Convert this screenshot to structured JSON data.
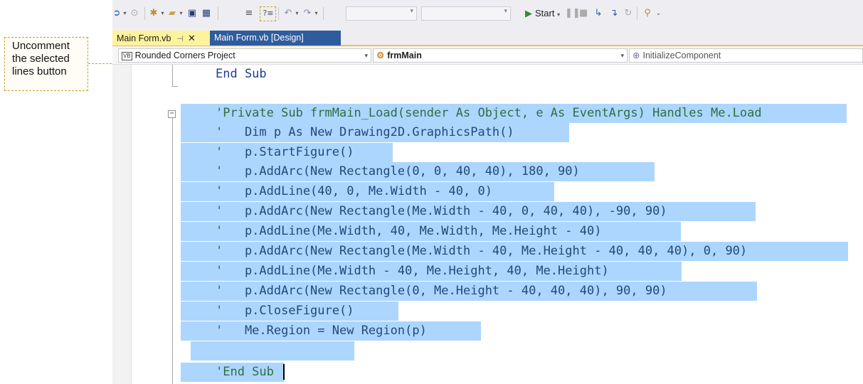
{
  "callout": {
    "text": "Uncomment\nthe selected\nlines button"
  },
  "toolbar": {
    "start_label": "Start",
    "buttons": [
      "back-icon",
      "forward-icon",
      "new-project-icon",
      "open-file-icon",
      "save-icon",
      "save-all-icon",
      "comment-icon",
      "uncomment-icon",
      "undo-icon",
      "redo-icon",
      "pause-icon",
      "stop-icon",
      "step-icon",
      "restart-icon",
      "find-icon"
    ]
  },
  "tabs": [
    {
      "label": "Main Form.vb",
      "active": true
    },
    {
      "label": "Main Form.vb [Design]",
      "active": false
    }
  ],
  "navbar": {
    "project": "Rounded Corners Project",
    "class": "frmMain",
    "member": "InitializeComponent"
  },
  "code": {
    "line1": "End Sub",
    "line2": "'Private Sub frmMain_Load(sender As Object, e As EventArgs) Handles Me.Load",
    "line3": "    Dim p As New Drawing2D.GraphicsPath()",
    "line4": "    p.StartFigure()",
    "line5": "    p.AddArc(New Rectangle(0, 0, 40, 40), 180, 90)",
    "line6": "    p.AddLine(40, 0, Me.Width - 40, 0)",
    "line7": "    p.AddArc(New Rectangle(Me.Width - 40, 0, 40, 40), -90, 90)",
    "line8": "    p.AddLine(Me.Width, 40, Me.Width, Me.Height - 40)",
    "line9": "    p.AddArc(New Rectangle(Me.Width - 40, Me.Height - 40, 40, 40), 0, 90)",
    "line10": "    p.AddLine(Me.Width - 40, Me.Height, 40, Me.Height)",
    "line11": "    p.AddArc(New Rectangle(0, Me.Height - 40, 40, 40), 90, 90)",
    "line12": "    p.CloseFigure()",
    "line13": "    Me.Region = New Region(p)",
    "line14": "'End Sub",
    "comment_prefix": "'"
  },
  "colors": {
    "selection": "#add6ff",
    "active_tab": "#fff29d",
    "design_tab": "#2f5c9c",
    "callout_border": "#c9a227"
  }
}
